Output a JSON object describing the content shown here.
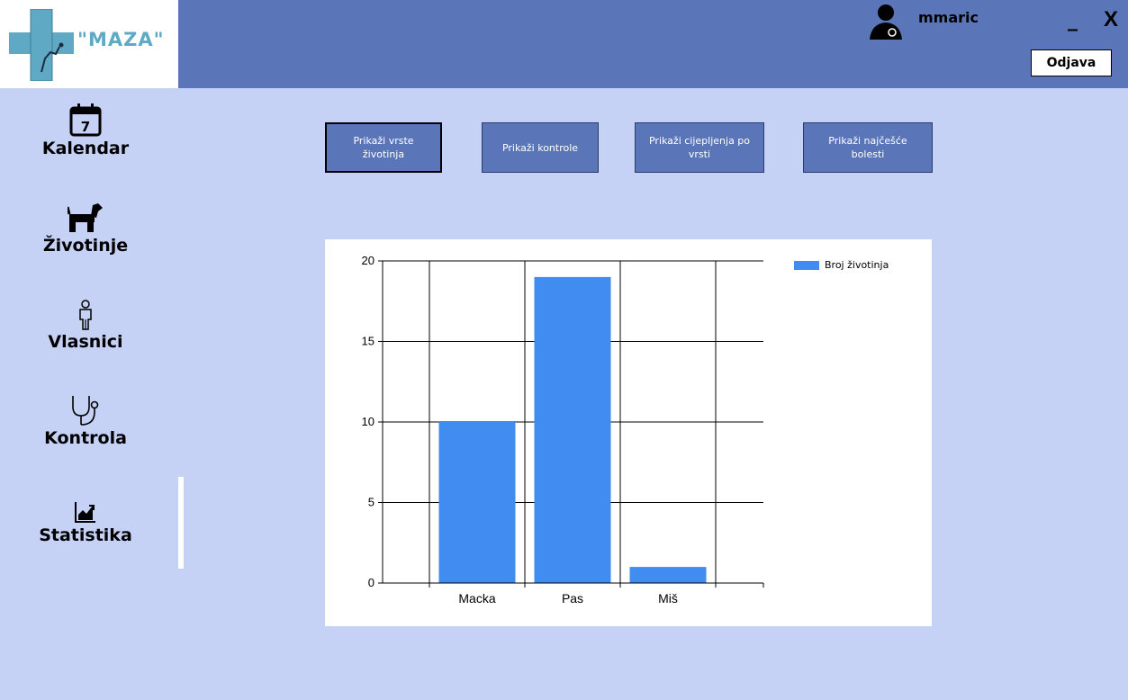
{
  "app": {
    "logo_text": "\"MAZA\"",
    "username": "mmaric",
    "minimize_label": "_",
    "close_label": "X",
    "logout_label": "Odjava"
  },
  "sidebar": {
    "items": [
      {
        "label": "Kalendar",
        "icon": "calendar-icon",
        "calendar_day": "7"
      },
      {
        "label": "Životinje",
        "icon": "dog-icon"
      },
      {
        "label": "Vlasnici",
        "icon": "person-icon"
      },
      {
        "label": "Kontrola",
        "icon": "stethoscope-icon"
      },
      {
        "label": "Statistika",
        "icon": "stats-icon",
        "active": true
      }
    ]
  },
  "toolbar": {
    "buttons": [
      {
        "label": "Prikaži vrste životinja",
        "active": true
      },
      {
        "label": "Prikaži kontrole"
      },
      {
        "label": "Prikaži cijepljenja po vrsti"
      },
      {
        "label": "Prikaži najčešće bolesti"
      }
    ]
  },
  "colors": {
    "header": "#5a76b8",
    "background": "#c6d2f5",
    "bar": "#418cf0"
  },
  "chart_data": {
    "type": "bar",
    "categories": [
      "Macka",
      "Pas",
      "Miš"
    ],
    "series": [
      {
        "name": "Broj životinja",
        "values": [
          10,
          19,
          1
        ]
      }
    ],
    "ylim": [
      0,
      20
    ],
    "yticks": [
      0,
      5,
      10,
      15,
      20
    ],
    "grid": true,
    "legend_position": "top-right"
  }
}
